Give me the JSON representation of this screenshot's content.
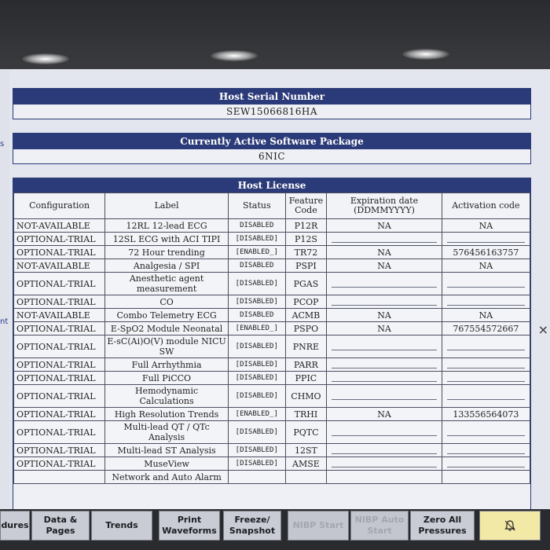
{
  "host_serial": {
    "title": "Host Serial Number",
    "value": "SEW15066816HA"
  },
  "software_package": {
    "title": "Currently Active Software Package",
    "value": "6NIC"
  },
  "edge_left": {
    "top": "s",
    "mid": "nt"
  },
  "edge_right": "×",
  "license": {
    "title": "Host License",
    "headers": {
      "configuration": "Configuration",
      "label": "Label",
      "status": "Status",
      "feature_code": "Feature Code",
      "expiration": "Expiration date (DDMMYYYY)",
      "activation": "Activation code"
    },
    "rows": [
      {
        "cfg": "NOT-AVAILABLE",
        "label": "12RL 12-lead ECG",
        "status": "DISABLED",
        "code": "P12R",
        "exp": "NA",
        "act": "NA"
      },
      {
        "cfg": "OPTIONAL-TRIAL",
        "label": "12SL ECG with ACI TIPI",
        "status": "[DISABLED]",
        "code": "P12S",
        "exp": "",
        "act": ""
      },
      {
        "cfg": "OPTIONAL-TRIAL",
        "label": "72 Hour trending",
        "status": "[ENABLED_]",
        "code": "TR72",
        "exp": "NA",
        "act": "576456163757"
      },
      {
        "cfg": "NOT-AVAILABLE",
        "label": "Analgesia / SPI",
        "status": "DISABLED",
        "code": "PSPI",
        "exp": "NA",
        "act": "NA"
      },
      {
        "cfg": "OPTIONAL-TRIAL",
        "label": "Anesthetic agent measurement",
        "status": "[DISABLED]",
        "code": "PGAS",
        "exp": "",
        "act": ""
      },
      {
        "cfg": "OPTIONAL-TRIAL",
        "label": "CO",
        "status": "[DISABLED]",
        "code": "PCOP",
        "exp": "",
        "act": ""
      },
      {
        "cfg": "NOT-AVAILABLE",
        "label": "Combo Telemetry ECG",
        "status": "DISABLED",
        "code": "ACMB",
        "exp": "NA",
        "act": "NA"
      },
      {
        "cfg": "OPTIONAL-TRIAL",
        "label": "E-SpO2 Module Neonatal",
        "status": "[ENABLED_]",
        "code": "PSPO",
        "exp": "NA",
        "act": "767554572667"
      },
      {
        "cfg": "OPTIONAL-TRIAL",
        "label": "E-sC(Ai)O(V) module NICU SW",
        "status": "[DISABLED]",
        "code": "PNRE",
        "exp": "",
        "act": ""
      },
      {
        "cfg": "OPTIONAL-TRIAL",
        "label": "Full Arrhythmia",
        "status": "[DISABLED]",
        "code": "PARR",
        "exp": "",
        "act": ""
      },
      {
        "cfg": "OPTIONAL-TRIAL",
        "label": "Full PiCCO",
        "status": "[DISABLED]",
        "code": "PPIC",
        "exp": "",
        "act": ""
      },
      {
        "cfg": "OPTIONAL-TRIAL",
        "label": "Hemodynamic Calculations",
        "status": "[DISABLED]",
        "code": "CHMO",
        "exp": "",
        "act": ""
      },
      {
        "cfg": "OPTIONAL-TRIAL",
        "label": "High Resolution Trends",
        "status": "[ENABLED_]",
        "code": "TRHI",
        "exp": "NA",
        "act": "133556564073"
      },
      {
        "cfg": "OPTIONAL-TRIAL",
        "label": "Multi-lead QT / QTc Analysis",
        "status": "[DISABLED]",
        "code": "PQTC",
        "exp": "",
        "act": ""
      },
      {
        "cfg": "OPTIONAL-TRIAL",
        "label": "Multi-lead ST Analysis",
        "status": "[DISABLED]",
        "code": "12ST",
        "exp": "",
        "act": ""
      },
      {
        "cfg": "OPTIONAL-TRIAL",
        "label": "MuseView",
        "status": "[DISABLED]",
        "code": "AMSE",
        "exp": "",
        "act": ""
      },
      {
        "cfg": "",
        "label": "Network and Auto Alarm",
        "status": "",
        "code": "",
        "exp": "",
        "act": ""
      }
    ]
  },
  "toolbar": {
    "procedures": "dures",
    "data_pages": "Data & Pages",
    "trends": "Trends",
    "print_waveforms": "Print Waveforms",
    "freeze_snapshot": "Freeze/ Snapshot",
    "nibp_start": "NIBP Start",
    "nibp_auto_start": "NIBP Auto Start",
    "zero_all_pressures": "Zero All Pressures",
    "alarm_icon": "bell-icon"
  },
  "colors": {
    "header_blue": "#2b3a78",
    "alarm_yellow": "#f2e9a6"
  }
}
